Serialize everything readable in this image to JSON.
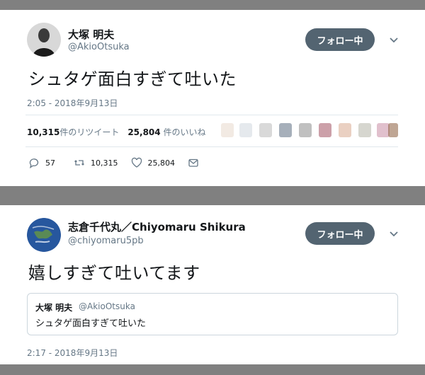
{
  "colors": {
    "follow_bg": "#536471",
    "text": "#14171a",
    "muted": "#657786",
    "page_bg": "#808080"
  },
  "tweet1": {
    "display_name": "大塚 明夫",
    "handle": "@AkioOtsuka",
    "follow_label": "フォロー中",
    "text": "シュタゲ面白すぎて吐いた",
    "timestamp": "2:05 - 2018年9月13日",
    "retweet_count": "10,315",
    "retweet_suffix": "件のリツイート",
    "like_count": "25,804",
    "like_suffix": " 件のいいね",
    "action_reply": "57",
    "action_retweet": "10,315",
    "action_like": "25,804",
    "icons": [
      "reply-icon",
      "retweet-icon",
      "heart-icon",
      "message-icon",
      "chevron-down-icon"
    ]
  },
  "tweet2": {
    "display_name": "志倉千代丸／Chiyomaru Shikura",
    "handle": "@chiyomaru5pb",
    "follow_label": "フォロー中",
    "text": "嬉しすぎて吐いてます",
    "timestamp": "2:17 - 2018年9月13日",
    "quote": {
      "display_name": "大塚 明夫",
      "handle": "@AkioOtsuka",
      "text": "シュタゲ面白すぎて吐いた"
    }
  }
}
